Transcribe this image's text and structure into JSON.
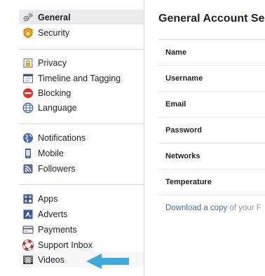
{
  "sidebar": {
    "groups": [
      {
        "items": [
          {
            "label": "General",
            "icon": "gears-icon",
            "active": true
          },
          {
            "label": "Security",
            "icon": "security-badge-icon"
          }
        ]
      },
      {
        "items": [
          {
            "label": "Privacy",
            "icon": "privacy-lock-icon"
          },
          {
            "label": "Timeline and Tagging",
            "icon": "timeline-icon"
          },
          {
            "label": "Blocking",
            "icon": "blocking-icon"
          },
          {
            "label": "Language",
            "icon": "globe-icon"
          }
        ]
      },
      {
        "items": [
          {
            "label": "Notifications",
            "icon": "notifications-globe-icon"
          },
          {
            "label": "Mobile",
            "icon": "mobile-phone-icon"
          },
          {
            "label": "Followers",
            "icon": "rss-icon"
          }
        ]
      },
      {
        "items": [
          {
            "label": "Apps",
            "icon": "apps-grid-icon"
          },
          {
            "label": "Adverts",
            "icon": "adverts-icon"
          },
          {
            "label": "Payments",
            "icon": "credit-card-icon"
          },
          {
            "label": "Support Inbox",
            "icon": "lifebuoy-icon"
          },
          {
            "label": "Videos",
            "icon": "film-strip-icon",
            "highlighted": true
          }
        ]
      }
    ]
  },
  "main": {
    "title": "General Account Se",
    "rows": [
      {
        "label": "Name"
      },
      {
        "label": "Username"
      },
      {
        "label": "Email"
      },
      {
        "label": "Password"
      },
      {
        "label": "Networks"
      },
      {
        "label": "Temperature"
      }
    ],
    "download": {
      "link": "Download a copy",
      "rest": " of your F"
    }
  },
  "annotation": {
    "arrow_icon": "arrow-left-icon",
    "arrow_color": "#3fa9dc"
  },
  "colors": {
    "active_bg": "#e9ebee",
    "separator": "#d3d6db",
    "link": "#4b67a1"
  }
}
